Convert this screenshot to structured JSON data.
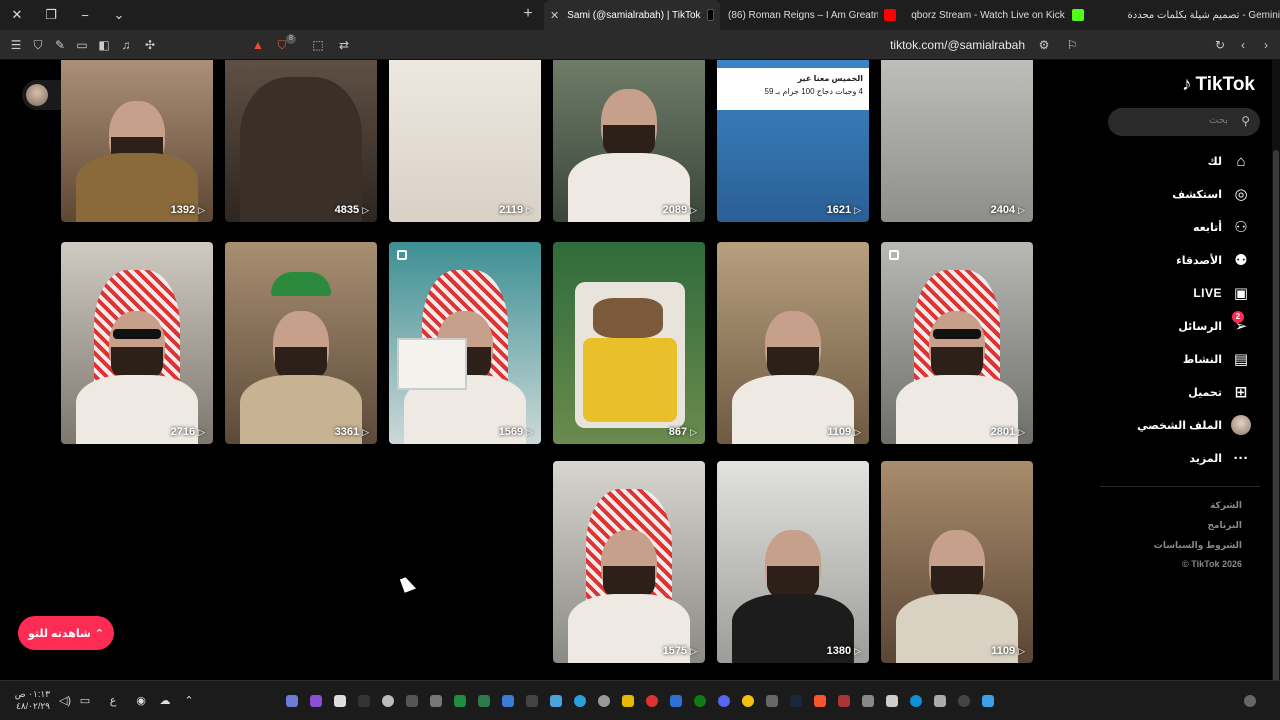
{
  "browser": {
    "tabs": [
      {
        "title": "Sami (@samialrabah) | TikTok",
        "active": true
      },
      {
        "title": "(86) Roman Reigns – I Am Greatness",
        "active": false
      },
      {
        "title": "qborz Stream - Watch Live on Kick",
        "active": false
      },
      {
        "title": "Gemini - تصميم شيلة بكلمات محددة",
        "active": false
      }
    ],
    "url": "tiktok.com/@samialrabah",
    "shield_badge": "8"
  },
  "tiktok": {
    "logo": "TikTok",
    "search_placeholder": "بحث",
    "nav": [
      {
        "label": "لك",
        "icon": "home-icon"
      },
      {
        "label": "استكشف",
        "icon": "compass-icon"
      },
      {
        "label": "أتابعه",
        "icon": "following-icon"
      },
      {
        "label": "الأصدقاء",
        "icon": "friends-icon"
      },
      {
        "label": "LIVE",
        "icon": "live-icon"
      },
      {
        "label": "الرسائل",
        "icon": "messages-icon",
        "badge": "2"
      },
      {
        "label": "النشاط",
        "icon": "activity-icon"
      },
      {
        "label": "تحميل",
        "icon": "upload-icon"
      },
      {
        "label": "الملف الشخصي",
        "icon": "profile-avatar"
      },
      {
        "label": "المزيد",
        "icon": "more-icon"
      }
    ],
    "footer": [
      "الشركة",
      "البرنامج",
      "الشروط والسياسات",
      "© TikTok 2026"
    ],
    "watch_button": "شاهدته للتو",
    "videos": [
      {
        "views": "1392"
      },
      {
        "views": "4835"
      },
      {
        "views": "2119"
      },
      {
        "views": "2089"
      },
      {
        "views": "1621",
        "ad_line1": "الخميس معنا غير",
        "ad_line2": "4 وجبات دجاج 100 جرام بـ 59"
      },
      {
        "views": "2404"
      },
      {
        "views": "2716"
      },
      {
        "views": "3361"
      },
      {
        "views": "1569"
      },
      {
        "views": "867"
      },
      {
        "views": "1109"
      },
      {
        "views": "2801"
      },
      {
        "views": "1575"
      },
      {
        "views": "1380"
      },
      {
        "views": "1109"
      }
    ]
  },
  "taskbar": {
    "time": "٠١:١٣ ص",
    "date": "٤٨/٠٢/٢٩",
    "lang": "ع"
  }
}
